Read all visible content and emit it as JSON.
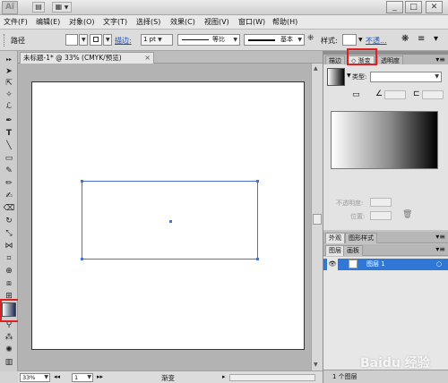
{
  "app": {
    "logo": "Ai"
  },
  "titlebar": {
    "minimize": "_",
    "restore": "□",
    "close": "✕"
  },
  "menu": [
    "文件(F)",
    "编辑(E)",
    "对象(O)",
    "文字(T)",
    "选择(S)",
    "效果(C)",
    "视图(V)",
    "窗口(W)",
    "帮助(H)"
  ],
  "control": {
    "label": "路径",
    "stroke_label": "描边:",
    "stroke_value": "1 pt",
    "stroke_profile": "等比",
    "brush": "基本",
    "style_label": "样式:",
    "opacity_label": "不透..."
  },
  "document": {
    "tab_title": "未标题-1* @ 33% (CMYK/预览)",
    "close": "×"
  },
  "status": {
    "zoom": "33%",
    "page": "1",
    "tool": "渐变"
  },
  "panels": {
    "top_tabs": [
      "描边",
      "渐变",
      "透明度"
    ],
    "type_label": "类型:",
    "opacity_label": "不透明度:",
    "location_label": "位置:",
    "mid_tabs": [
      "外观",
      "图形样式"
    ],
    "layer_tabs": [
      "图层",
      "画板"
    ],
    "layer_name": "图层 1",
    "layers_footer": "1 个图层"
  },
  "watermark": "Baidu 经验",
  "colors": {
    "highlight": "#e02020",
    "selection": "#4a72c8",
    "layer_selected": "#2f78d6"
  }
}
